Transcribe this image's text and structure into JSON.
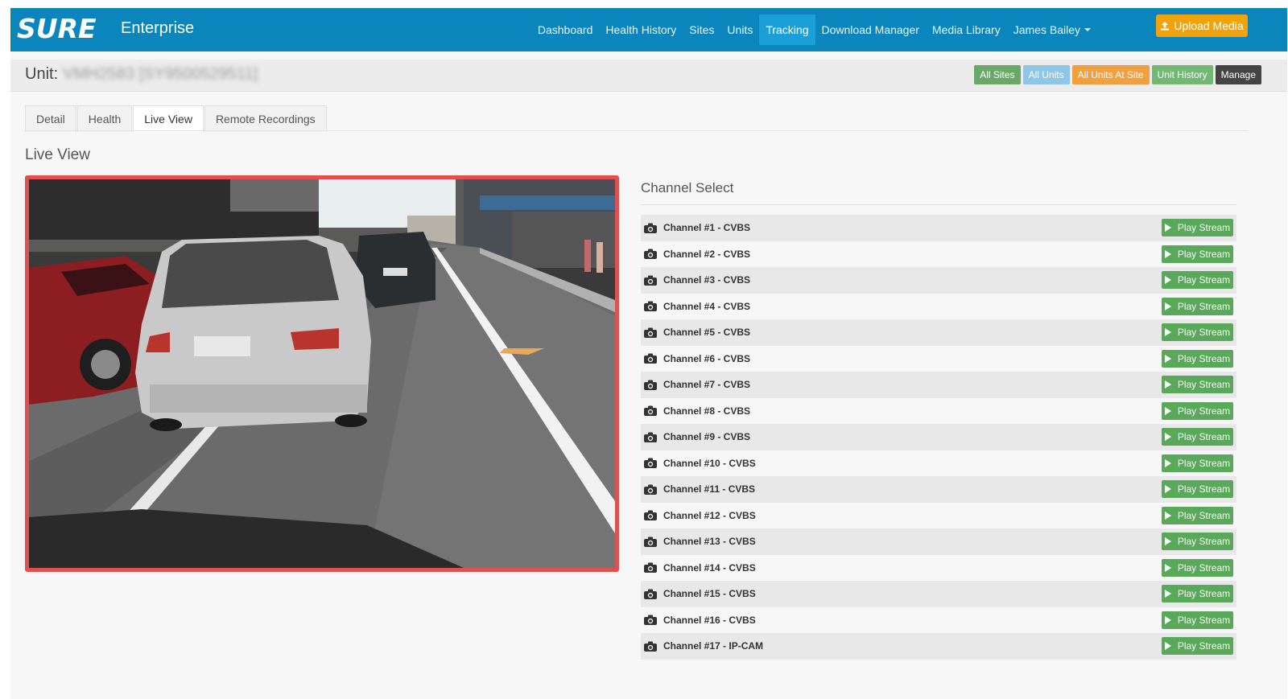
{
  "app": {
    "logo": "SURE",
    "subtitle": "Enterprise"
  },
  "nav": {
    "items": [
      {
        "label": "Dashboard",
        "name": "nav-dashboard"
      },
      {
        "label": "Health History",
        "name": "nav-health-history"
      },
      {
        "label": "Sites",
        "name": "nav-sites"
      },
      {
        "label": "Units",
        "name": "nav-units"
      },
      {
        "label": "Tracking",
        "name": "nav-tracking"
      },
      {
        "label": "Download Manager",
        "name": "nav-download-manager"
      },
      {
        "label": "Media Library",
        "name": "nav-media-library"
      }
    ],
    "active_index": 4,
    "user": "James Bailey",
    "upload_label": "Upload Media"
  },
  "unit": {
    "label": "Unit:",
    "id": "VMH2583 [SY9500529511]"
  },
  "unit_actions": [
    {
      "label": "All Sites",
      "color": "#6aa86a"
    },
    {
      "label": "All Units",
      "color": "#8ec6e6"
    },
    {
      "label": "All Units At Site",
      "color": "#f0a040"
    },
    {
      "label": "Unit History",
      "color": "#72b872"
    },
    {
      "label": "Manage",
      "color": "#444444"
    }
  ],
  "tabs": {
    "items": [
      "Detail",
      "Health",
      "Live View",
      "Remote Recordings"
    ],
    "active_index": 2
  },
  "live_view": {
    "title": "Live View",
    "channel_select_title": "Channel Select",
    "play_label": "Play Stream",
    "channels": [
      "Channel #1 - CVBS",
      "Channel #2 - CVBS",
      "Channel #3 - CVBS",
      "Channel #4 - CVBS",
      "Channel #5 - CVBS",
      "Channel #6 - CVBS",
      "Channel #7 - CVBS",
      "Channel #8 - CVBS",
      "Channel #9 - CVBS",
      "Channel #10 - CVBS",
      "Channel #11 - CVBS",
      "Channel #12 - CVBS",
      "Channel #13 - CVBS",
      "Channel #14 - CVBS",
      "Channel #15 - CVBS",
      "Channel #16 - CVBS",
      "Channel #17 - IP-CAM"
    ]
  },
  "icons": {
    "upload": "upload-icon",
    "camera": "camera-icon",
    "play": "play-icon",
    "caret": "caret-down-icon"
  },
  "colors": {
    "nav_bg": "#0a86bd",
    "nav_active": "#1a9fd6",
    "upload": "#f0a30a",
    "play_stream": "#5aa85a",
    "video_border": "#e05050"
  }
}
